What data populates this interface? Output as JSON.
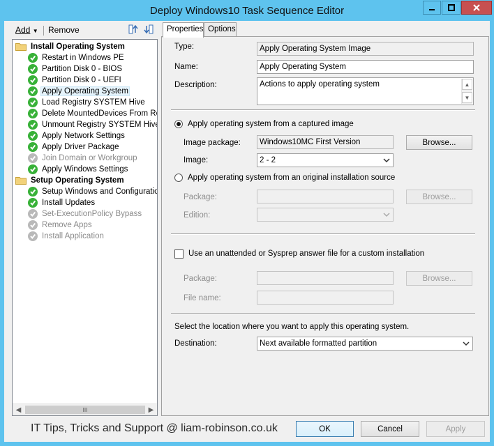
{
  "window": {
    "title": "Deploy Windows10 Task Sequence Editor",
    "minimize_icon": "minimize-icon",
    "maximize_icon": "maximize-icon",
    "close_icon": "close-icon"
  },
  "toolbar": {
    "add_label": "Add",
    "remove_label": "Remove",
    "move_up_icon": "move-up-icon",
    "move_down_icon": "move-down-icon"
  },
  "tree": {
    "items": [
      {
        "label": "Install Operating System",
        "type": "group"
      },
      {
        "label": "Restart in Windows PE",
        "type": "ok"
      },
      {
        "label": "Partition Disk 0 - BIOS",
        "type": "ok"
      },
      {
        "label": "Partition Disk 0 - UEFI",
        "type": "ok"
      },
      {
        "label": "Apply Operating System",
        "type": "ok",
        "selected": true
      },
      {
        "label": "Load Registry SYSTEM Hive",
        "type": "ok"
      },
      {
        "label": "Delete MountedDevices From Reg",
        "type": "ok"
      },
      {
        "label": "Unmount Registry SYSTEM Hive",
        "type": "ok"
      },
      {
        "label": "Apply Network Settings",
        "type": "ok"
      },
      {
        "label": "Apply Driver Package",
        "type": "ok"
      },
      {
        "label": "Join Domain or Workgroup",
        "type": "disabled"
      },
      {
        "label": "Apply Windows Settings",
        "type": "ok"
      },
      {
        "label": "Setup Operating System",
        "type": "group"
      },
      {
        "label": "Setup Windows and Configuration",
        "type": "ok"
      },
      {
        "label": "Install Updates",
        "type": "ok"
      },
      {
        "label": "Set-ExecutionPolicy Bypass",
        "type": "disabled"
      },
      {
        "label": "Remove Apps",
        "type": "disabled"
      },
      {
        "label": "Install Application",
        "type": "disabled"
      }
    ],
    "scroll_grip": "III"
  },
  "tabs": [
    {
      "label": "Properties",
      "active": true
    },
    {
      "label": "Options",
      "active": false
    }
  ],
  "properties": {
    "type_label": "Type:",
    "type_value": "Apply Operating System Image",
    "name_label": "Name:",
    "name_value": "Apply Operating System",
    "description_label": "Description:",
    "description_value": "Actions to apply operating system",
    "captured_image_radio": "Apply operating system from a captured image",
    "image_package_label": "Image package:",
    "image_package_value": "Windows10MC First Version",
    "browse_label": "Browse...",
    "image_label": "Image:",
    "image_value": "2 - 2",
    "original_source_radio": "Apply operating system from an original installation source",
    "package_label": "Package:",
    "edition_label": "Edition:",
    "unattend_checkbox": "Use an unattended or Sysprep answer file for a custom installation",
    "unattend_package_label": "Package:",
    "file_name_label": "File name:",
    "location_text": "Select the location where you want to apply this operating system.",
    "destination_label": "Destination:",
    "destination_value": "Next available formatted partition"
  },
  "footer": {
    "watermark": "IT Tips, Tricks and Support @ liam-robinson.co.uk",
    "ok_label": "OK",
    "cancel_label": "Cancel",
    "apply_label": "Apply"
  }
}
